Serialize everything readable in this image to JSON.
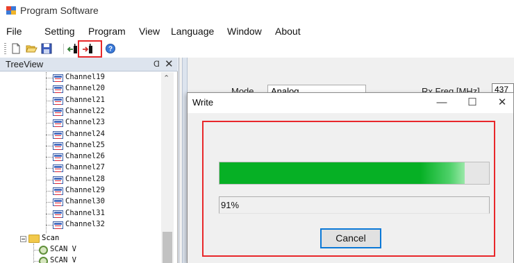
{
  "app": {
    "title": "Program Software"
  },
  "menu": {
    "items": [
      "File",
      "Setting",
      "Program",
      "View",
      "Language",
      "Window",
      "About"
    ]
  },
  "toolbar": {
    "buttons": [
      "new-file-icon",
      "open-folder-icon",
      "save-icon",
      "read-device-icon",
      "write-device-icon",
      "help-icon"
    ],
    "highlight_color": "#e8272a"
  },
  "treeview": {
    "title": "TreeView",
    "pin_glyph": "Ɑ",
    "close_glyph": "✕",
    "channels": [
      "Channel19",
      "Channel20",
      "Channel21",
      "Channel22",
      "Channel23",
      "Channel24",
      "Channel25",
      "Channel26",
      "Channel27",
      "Channel28",
      "Channel29",
      "Channel30",
      "Channel31",
      "Channel32"
    ],
    "scan_folder": "Scan",
    "scan_items": [
      "SCAN V",
      "SCAN V"
    ]
  },
  "background_form": {
    "mode_label": "Mode",
    "mode_value": "Analog",
    "rx_label": "Rx Freq [MHz]",
    "rx_value": "437"
  },
  "dialog": {
    "title": "Write",
    "minimize_glyph": "—",
    "maximize_glyph": "☐",
    "close_glyph": "✕",
    "progress_percent": 91,
    "percent_text": "91%",
    "cancel_label": "Cancel",
    "progress_color": "#06b025"
  }
}
